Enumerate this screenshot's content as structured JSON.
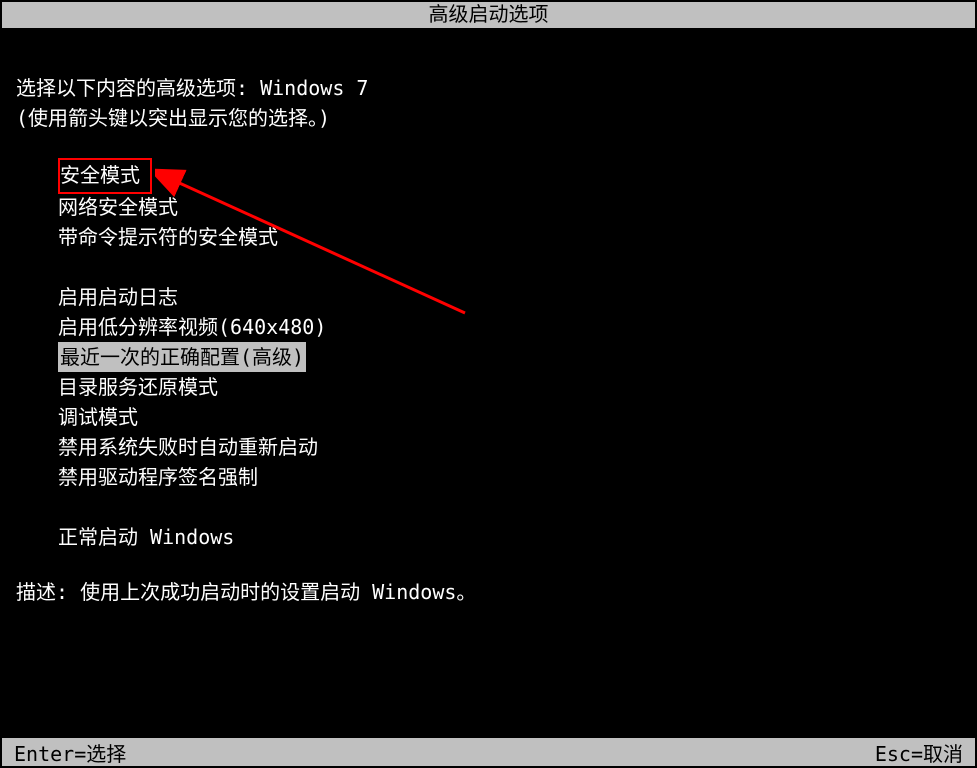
{
  "title": "高级启动选项",
  "prompt": {
    "prefix": "选择以下内容的高级选项: ",
    "os": "Windows 7"
  },
  "hint": "(使用箭头键以突出显示您的选择。)",
  "menu": {
    "group1": [
      {
        "label": "安全模式",
        "boxed": true
      },
      {
        "label": "网络安全模式"
      },
      {
        "label": "带命令提示符的安全模式"
      }
    ],
    "group2": [
      {
        "label": "启用启动日志"
      },
      {
        "label": "启用低分辨率视频(640x480)"
      },
      {
        "label": "最近一次的正确配置(高级)",
        "selected": true
      },
      {
        "label": "目录服务还原模式"
      },
      {
        "label": "调试模式"
      },
      {
        "label": "禁用系统失败时自动重新启动"
      },
      {
        "label": "禁用驱动程序签名强制"
      }
    ],
    "group3": [
      {
        "label": "正常启动 Windows"
      }
    ]
  },
  "description": {
    "prefix": "描述: ",
    "text": "使用上次成功启动时的设置启动 Windows。"
  },
  "footer": {
    "enter": "Enter=选择",
    "esc": "Esc=取消"
  }
}
